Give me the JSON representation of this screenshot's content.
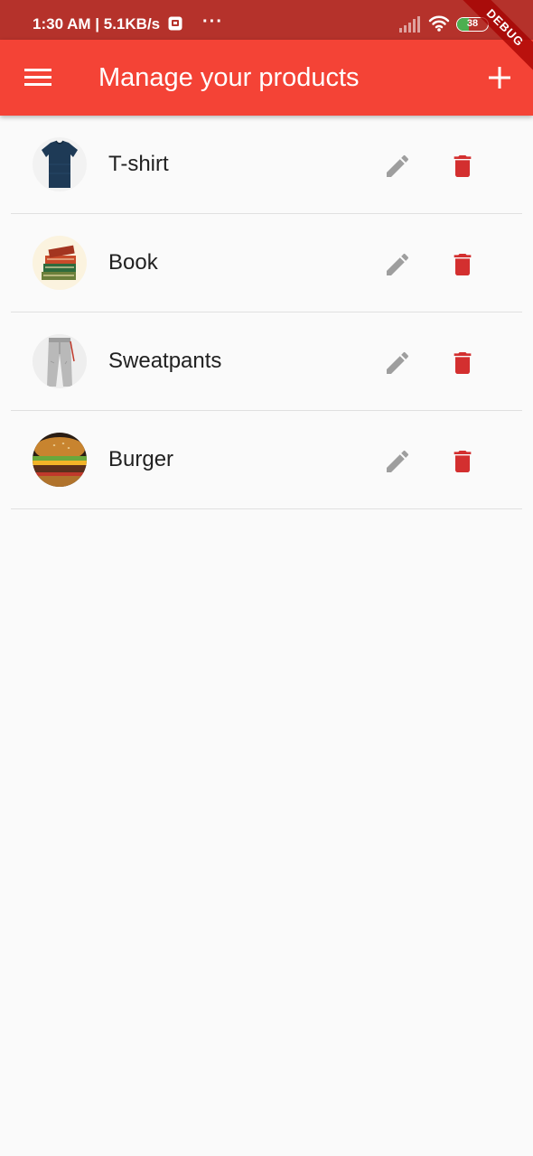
{
  "status_bar": {
    "text": "1:30 AM | 5.1KB/s",
    "more": "···",
    "battery": "38",
    "battery_level": 0.38
  },
  "app_bar": {
    "title": "Manage your products",
    "menu_icon": "hamburger-menu-icon",
    "add_icon": "plus-icon"
  },
  "debug_banner": "DEBUG",
  "products": [
    {
      "name": "T-shirt",
      "thumbnail": "t-shirt-thumbnail"
    },
    {
      "name": "Book",
      "thumbnail": "books-thumbnail"
    },
    {
      "name": "Sweatpants",
      "thumbnail": "sweatpants-thumbnail"
    },
    {
      "name": "Burger",
      "thumbnail": "burger-thumbnail"
    }
  ],
  "colors": {
    "app_bar": "#f44336",
    "status_bar": "#b5322b",
    "edit_icon": "#9e9e9e",
    "delete_icon": "#d32f2f",
    "background": "#fafafa"
  }
}
